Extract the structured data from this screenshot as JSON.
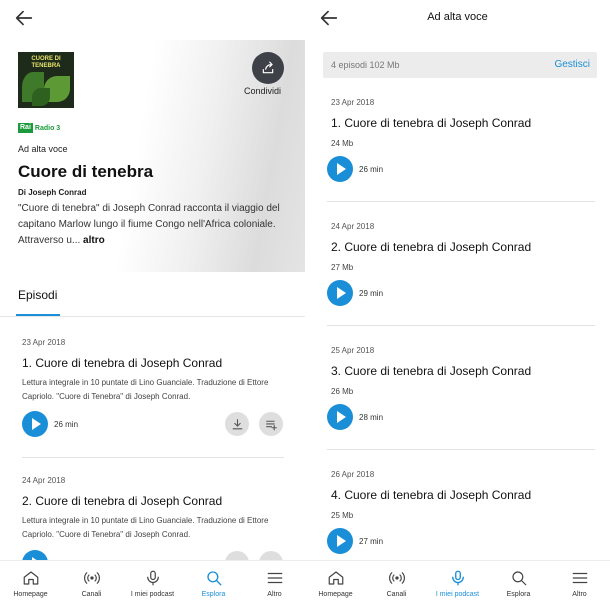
{
  "left": {
    "hero": {
      "cover_title": "CUORE DI TENEBRA",
      "cover_brand": "RaiRadio3",
      "share_label": "Condividi",
      "logo_box": "Rai",
      "logo_text": "Radio 3",
      "kicker": "Ad alta voce",
      "title": "Cuore di tenebra",
      "author": "Di Joseph Conrad",
      "description": "\"Cuore di tenebra\" di Joseph Conrad racconta il viaggio del capitano Marlow lungo il fiume Congo nell'Africa coloniale. Attraverso u...",
      "more": "altro"
    },
    "tab": "Episodi",
    "episodes": [
      {
        "date": "23 Apr 2018",
        "title": "1. Cuore di tenebra di Joseph Conrad",
        "desc": "Lettura integrale in 10 puntate di Lino Guanciale. Traduzione di Ettore Capriolo. \"Cuore di Tenebra\" di Joseph Conrad.",
        "duration": "26 min"
      },
      {
        "date": "24 Apr 2018",
        "title": "2. Cuore di tenebra di Joseph Conrad",
        "desc": "Lettura integrale in 10 puntate di Lino Guanciale. Traduzione di Ettore Capriolo. \"Cuore di Tenebra\" di Joseph Conrad.",
        "duration": ""
      }
    ]
  },
  "right": {
    "title": "Ad alta voce",
    "manage": {
      "info": "4 episodi 102 Mb",
      "link": "Gestisci"
    },
    "episodes": [
      {
        "date": "23 Apr 2018",
        "title": "1. Cuore di tenebra di Joseph Conrad",
        "size": "24 Mb",
        "duration": "26 min"
      },
      {
        "date": "24 Apr 2018",
        "title": "2. Cuore di tenebra di Joseph Conrad",
        "size": "27 Mb",
        "duration": "29 min"
      },
      {
        "date": "25 Apr 2018",
        "title": "3. Cuore di tenebra di Joseph Conrad",
        "size": "26 Mb",
        "duration": "28 min"
      },
      {
        "date": "26 Apr 2018",
        "title": "4. Cuore di tenebra di Joseph Conrad",
        "size": "25 Mb",
        "duration": "27 min"
      }
    ]
  },
  "nav": {
    "items": [
      "Homepage",
      "Canali",
      "I miei podcast",
      "Esplora",
      "Altro"
    ],
    "left_active": "Esplora",
    "right_active": "I miei podcast"
  },
  "colors": {
    "accent": "#1a8fd8",
    "share_bg": "#3e4248",
    "rai_green": "#1a9a3a"
  }
}
